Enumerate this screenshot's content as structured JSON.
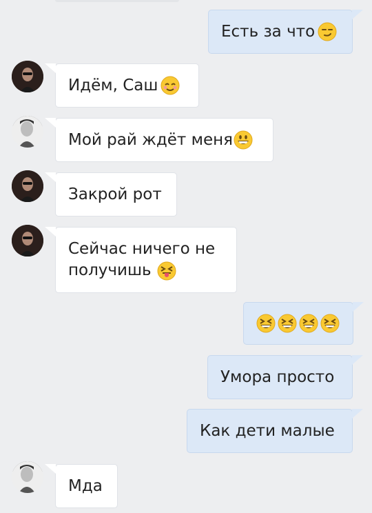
{
  "messages": [
    {
      "side": "out",
      "text": "Есть за что",
      "emoji": [
        "smirk-face"
      ]
    },
    {
      "side": "in",
      "sender": "girl",
      "text": "Идём, Саш",
      "emoji": [
        "relieved-face"
      ]
    },
    {
      "side": "in",
      "sender": "boy",
      "text": "Мой рай ждёт меня",
      "emoji": [
        "grinning-face"
      ]
    },
    {
      "side": "in",
      "sender": "girl",
      "text": "Закрой рот",
      "emoji": []
    },
    {
      "side": "in",
      "sender": "girl",
      "text_line1": "Сейчас ничего не",
      "text_line2": "получишь",
      "emoji": [
        "squinting-tongue-face"
      ]
    },
    {
      "side": "out",
      "text": "",
      "emoji": [
        "laughing-face",
        "laughing-face",
        "laughing-face",
        "laughing-face"
      ]
    },
    {
      "side": "out",
      "text": "Умора просто",
      "emoji": []
    },
    {
      "side": "out",
      "text": "Как дети малые",
      "emoji": []
    },
    {
      "side": "in",
      "sender": "boy",
      "text": "Мда",
      "emoji": []
    }
  ],
  "colors": {
    "background": "#edeef0",
    "incoming_bubble": "#ffffff",
    "outgoing_bubble": "#dce8f7",
    "text": "#222222"
  }
}
